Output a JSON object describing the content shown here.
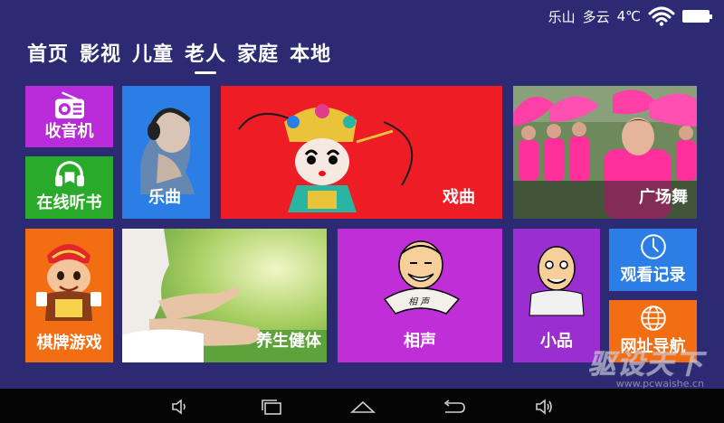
{
  "status_bar": {
    "location": "乐山",
    "weather": "多云",
    "temperature": "4℃",
    "icons": [
      "wifi-icon",
      "battery-icon"
    ]
  },
  "nav_tabs": [
    {
      "label": "首页",
      "active": false
    },
    {
      "label": "影视",
      "active": false
    },
    {
      "label": "儿童",
      "active": false
    },
    {
      "label": "老人",
      "active": true
    },
    {
      "label": "家庭",
      "active": false
    },
    {
      "label": "本地",
      "active": false
    }
  ],
  "tiles": {
    "radio": {
      "label": "收音机",
      "color": "#b92ad8",
      "icon": "radio-icon"
    },
    "audiobook": {
      "label": "在线听书",
      "color": "#2aaa2a",
      "icon": "headphones-icon"
    },
    "music": {
      "label": "乐曲",
      "color": "#2a7ee6"
    },
    "opera": {
      "label": "戏曲",
      "color": "#ee1c24"
    },
    "square_dance": {
      "label": "广场舞"
    },
    "chess": {
      "label": "棋牌游戏",
      "color": "#f36d12"
    },
    "wellness": {
      "label": "养生健体"
    },
    "crosstalk": {
      "label": "相声",
      "color": "#c02ed8",
      "fan_text": "相 声"
    },
    "sketch": {
      "label": "小品",
      "color": "#9a2ed0"
    },
    "history": {
      "label": "观看记录",
      "color": "#2a7ee6",
      "icon": "clock-icon"
    },
    "web_nav": {
      "label": "网址导航",
      "color": "#f36d12",
      "icon": "globe-icon"
    }
  },
  "system_nav": [
    "volume-down-icon",
    "recent-apps-icon",
    "home-icon",
    "back-icon",
    "volume-up-icon"
  ],
  "watermark": {
    "big": "驱设天下",
    "small": "www.pcwaishe.cn"
  }
}
